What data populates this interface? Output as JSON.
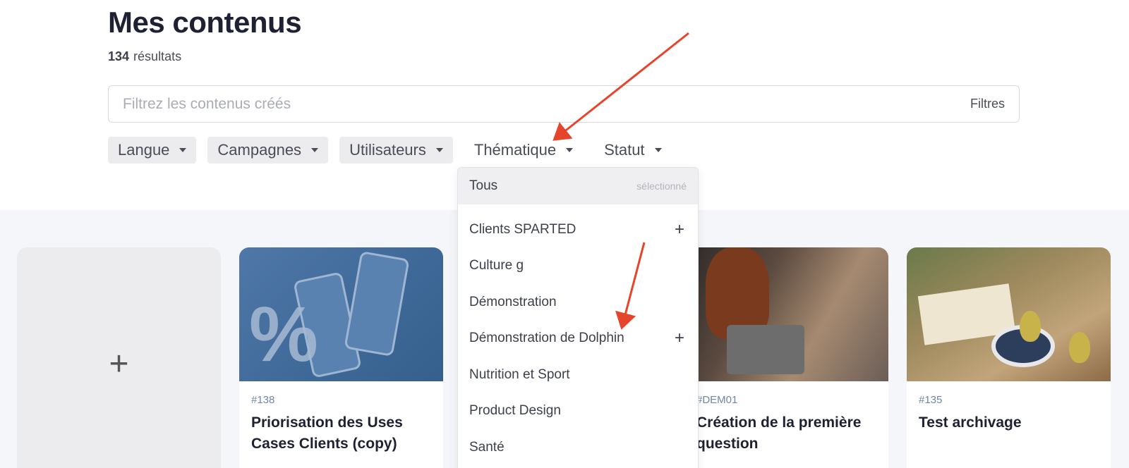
{
  "header": {
    "title": "Mes contenus",
    "results_count": "134",
    "results_label": "résultats"
  },
  "search": {
    "placeholder": "Filtrez les contenus créés",
    "filters_label": "Filtres"
  },
  "filter_chips": [
    {
      "label": "Langue",
      "active": true
    },
    {
      "label": "Campagnes",
      "active": true
    },
    {
      "label": "Utilisateurs",
      "active": true
    },
    {
      "label": "Thématique",
      "active": false
    },
    {
      "label": "Statut",
      "active": false
    }
  ],
  "dropdown": {
    "all_label": "Tous",
    "all_selected_label": "sélectionné",
    "items": [
      {
        "label": "Clients SPARTED",
        "expandable": true
      },
      {
        "label": "Culture g",
        "expandable": false
      },
      {
        "label": "Démonstration",
        "expandable": false
      },
      {
        "label": "Démonstration de Dolphin",
        "expandable": true
      },
      {
        "label": "Nutrition et Sport",
        "expandable": false
      },
      {
        "label": "Product Design",
        "expandable": false
      },
      {
        "label": "Santé",
        "expandable": false
      }
    ],
    "expand_symbol": "+"
  },
  "cards": [
    {
      "id": "#138",
      "name": "Priorisation des Uses Cases Clients (copy)"
    },
    {
      "id": "#DEM01",
      "name": "Création de la première question"
    },
    {
      "id": "#135",
      "name": "Test archivage"
    }
  ],
  "add_card": {
    "symbol": "+"
  },
  "colors": {
    "annotation_arrow": "#e5452b",
    "accent_id": "#6f86a8"
  }
}
